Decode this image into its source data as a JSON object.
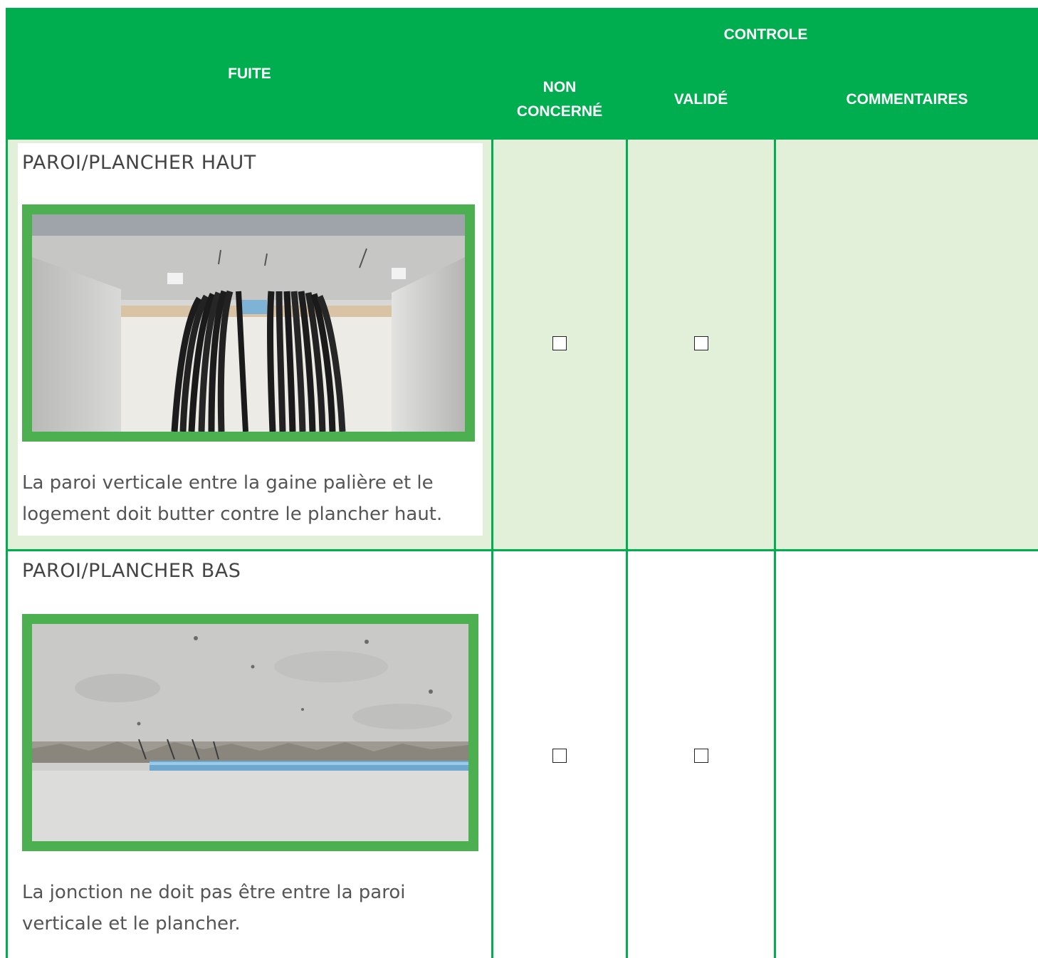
{
  "header": {
    "fuite": "FUITE",
    "controle": "CONTROLE",
    "non_concerne_line1": "NON",
    "non_concerne_line2": "CONCERNÉ",
    "valide": "VALIDÉ",
    "commentaires": "COMMENTAIRES"
  },
  "rows": [
    {
      "title": "PAROI/PLANCHER HAUT",
      "description": "La paroi verticale entre la gaine palière et le logement doit butter contre le plancher haut.",
      "non_concerne_checked": false,
      "valide_checked": false,
      "commentaires": ""
    },
    {
      "title": "PAROI/PLANCHER BAS",
      "description": "La jonction ne doit pas être entre la paroi verticale et le plancher.",
      "non_concerne_checked": false,
      "valide_checked": false,
      "commentaires": ""
    }
  ],
  "colors": {
    "header_green": "#00ae4f",
    "row_tint": "#e2efd9",
    "photo_frame": "#4caf50"
  }
}
